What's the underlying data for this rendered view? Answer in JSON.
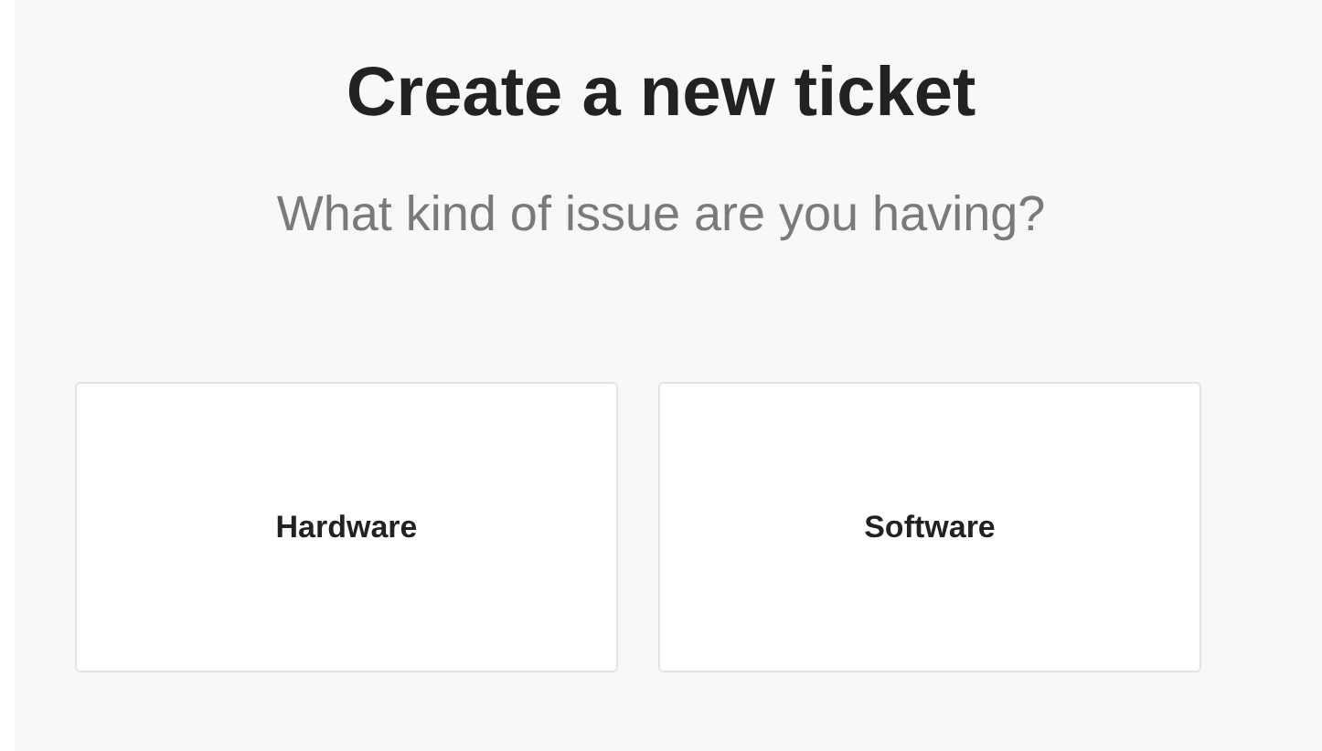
{
  "title": "Create a new ticket",
  "subtitle": "What kind of issue are you having?",
  "options": [
    {
      "label": "Hardware"
    },
    {
      "label": "Software"
    }
  ]
}
